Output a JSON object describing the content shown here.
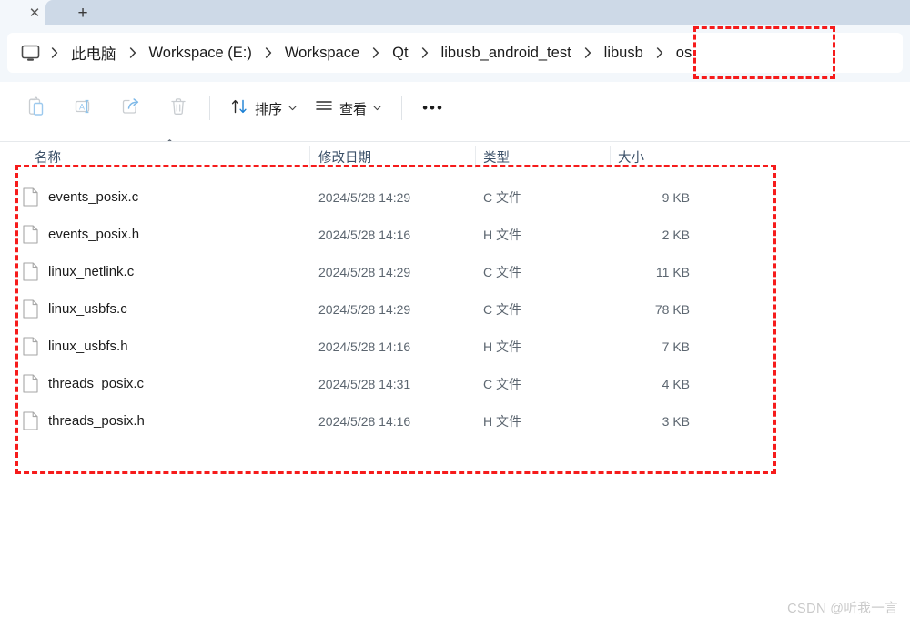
{
  "window": {
    "tabstrip": {
      "close_label": "✕",
      "new_tab_label": "+"
    }
  },
  "addressbar": {
    "pc_icon": "monitor-icon",
    "separator_icon": "chevron-right-icon",
    "breadcrumbs": [
      "此电脑",
      "Workspace (E:)",
      "Workspace",
      "Qt",
      "libusb_android_test",
      "libusb",
      "os"
    ]
  },
  "toolbar": {
    "buttons": [
      {
        "name": "paste-button",
        "icon": "clipboard-paste-icon",
        "disabled": true
      },
      {
        "name": "rename-button",
        "icon": "rename-icon",
        "disabled": true
      },
      {
        "name": "share-button",
        "icon": "share-icon",
        "disabled": true
      },
      {
        "name": "delete-button",
        "icon": "trash-icon",
        "disabled": true
      }
    ],
    "sort_label": "排序",
    "view_label": "查看",
    "caret_glyph": "⌄",
    "more_label": "•••"
  },
  "columns": {
    "headers": [
      "名称",
      "修改日期",
      "类型",
      "大小"
    ],
    "sort_indicator": "⌃",
    "sorted_by": "名称"
  },
  "files": [
    {
      "name": "events_posix.c",
      "date": "2024/5/28 14:29",
      "type": "C 文件",
      "size": "9 KB"
    },
    {
      "name": "events_posix.h",
      "date": "2024/5/28 14:16",
      "type": "H 文件",
      "size": "2 KB"
    },
    {
      "name": "linux_netlink.c",
      "date": "2024/5/28 14:29",
      "type": "C 文件",
      "size": "11 KB"
    },
    {
      "name": "linux_usbfs.c",
      "date": "2024/5/28 14:29",
      "type": "C 文件",
      "size": "78 KB"
    },
    {
      "name": "linux_usbfs.h",
      "date": "2024/5/28 14:16",
      "type": "H 文件",
      "size": "7 KB"
    },
    {
      "name": "threads_posix.c",
      "date": "2024/5/28 14:31",
      "type": "C 文件",
      "size": "4 KB"
    },
    {
      "name": "threads_posix.h",
      "date": "2024/5/28 14:16",
      "type": "H 文件",
      "size": "3 KB"
    }
  ],
  "annotations": {
    "color": "#f61b1b",
    "boxes": [
      {
        "name": "breadcrumb-highlight",
        "target": "libusb > os"
      },
      {
        "name": "filelist-highlight",
        "target": "file list"
      }
    ]
  },
  "watermark": {
    "text": "CSDN @听我一言"
  },
  "colors": {
    "tab_active": "#cdd9e7",
    "chrome_bg": "#f3f7fb",
    "accent_blue": "#0f6cbd",
    "annotation_red": "#f61b1b",
    "header_text": "#3b5068",
    "meta_text": "#5c6670"
  }
}
